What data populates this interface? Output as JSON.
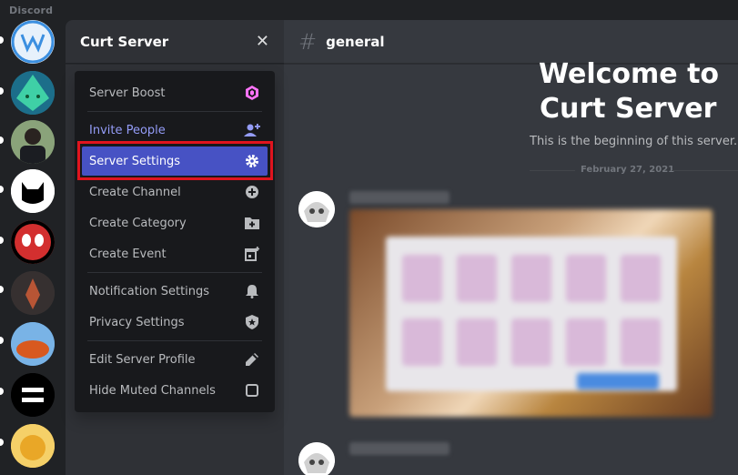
{
  "app": {
    "title": "Discord"
  },
  "sidebar": {
    "server_name": "Curt Server",
    "close_icon": "close-icon",
    "collapse_hint": "ˇ"
  },
  "main": {
    "channel_name": "general",
    "welcome_line1": "Welcome to",
    "welcome_line2": "Curt Server",
    "welcome_sub": "This is the beginning of this server.",
    "date_divider": "February 27, 2021"
  },
  "menu": {
    "items": [
      {
        "label": "Server Boost",
        "icon": "boost-icon"
      },
      {
        "label": "Invite People",
        "icon": "add-person-icon"
      },
      {
        "label": "Server Settings",
        "icon": "gear-icon"
      },
      {
        "label": "Create Channel",
        "icon": "plus-circle-icon"
      },
      {
        "label": "Create Category",
        "icon": "folder-plus-icon"
      },
      {
        "label": "Create Event",
        "icon": "calendar-plus-icon"
      },
      {
        "label": "Notification Settings",
        "icon": "bell-icon"
      },
      {
        "label": "Privacy Settings",
        "icon": "shield-star-icon"
      },
      {
        "label": "Edit Server Profile",
        "icon": "pencil-icon"
      },
      {
        "label": "Hide Muted Channels",
        "icon": "checkbox-icon"
      }
    ]
  },
  "colors": {
    "accent": "#4752c4",
    "highlight_border": "#e0141e",
    "invite": "#949cf7",
    "boost": "#ff73fa"
  }
}
